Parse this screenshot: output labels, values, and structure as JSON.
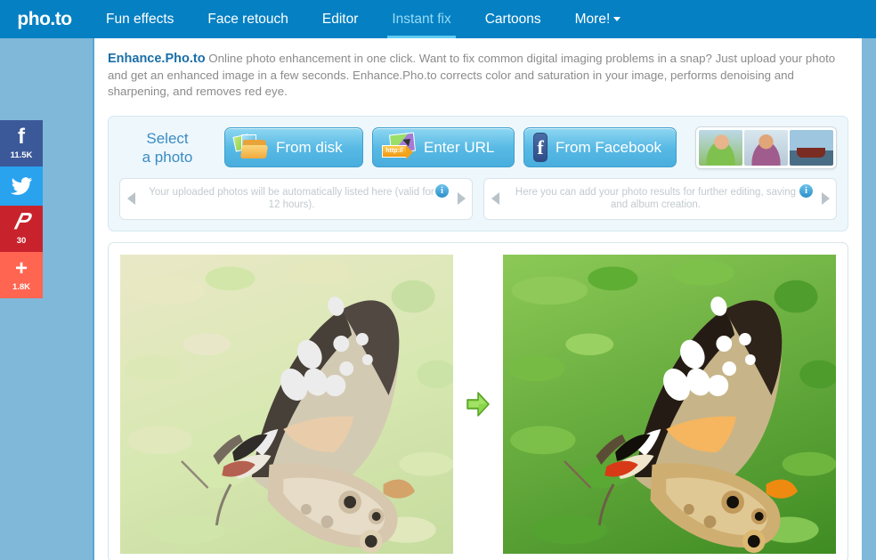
{
  "header": {
    "logo": "pho.to",
    "nav": [
      {
        "label": "Fun effects",
        "active": false
      },
      {
        "label": "Face retouch",
        "active": false
      },
      {
        "label": "Editor",
        "active": false
      },
      {
        "label": "Instant fix",
        "active": true
      },
      {
        "label": "Cartoons",
        "active": false
      },
      {
        "label": "More!",
        "active": false,
        "has_caret": true
      }
    ],
    "accent_color": "#0580c3",
    "active_color": "#96dcf5"
  },
  "social": [
    {
      "network": "facebook",
      "icon": "facebook-icon",
      "glyph": "f",
      "count": "11.5K",
      "color": "#3b5998"
    },
    {
      "network": "twitter",
      "icon": "twitter-icon",
      "glyph": "",
      "count": "",
      "color": "#2aa3ef"
    },
    {
      "network": "pinterest",
      "icon": "pinterest-icon",
      "glyph": "P",
      "count": "30",
      "color": "#c8232c"
    },
    {
      "network": "share",
      "icon": "plus-icon",
      "glyph": "+",
      "count": "1.8K",
      "color": "#ff6550"
    }
  ],
  "intro": {
    "title": "Enhance.Pho.to",
    "body": " Online photo enhancement in one click. Want to fix common digital imaging problems in a snap? Just upload your photo and get an enhanced image in a few seconds. Enhance.Pho.to corrects color and saturation in your image, performs denoising and sharpening, and removes red eye."
  },
  "select_panel": {
    "label_line1": "Select",
    "label_line2": "a photo",
    "buttons": [
      {
        "label": "From disk",
        "icon": "folder-photos-icon"
      },
      {
        "label": "Enter URL",
        "icon": "url-link-icon"
      },
      {
        "label": "From Facebook",
        "icon": "facebook-square-icon"
      }
    ],
    "samples": [
      {
        "name": "sample-woman",
        "alt": "woman portrait"
      },
      {
        "name": "sample-man",
        "alt": "man portrait"
      },
      {
        "name": "sample-ship",
        "alt": "ship photo"
      }
    ],
    "carousels": [
      {
        "text": "Your uploaded photos will be automatically listed here (valid for 12 hours).",
        "info": "i",
        "prev": "◀",
        "next": "▶"
      },
      {
        "text": "Here you can add your photo results for further editing, saving and album creation.",
        "info": "i",
        "prev": "◀",
        "next": "▶"
      }
    ]
  },
  "result": {
    "before_alt": "Painted Lady butterfly on green leaves, original washed-out photo",
    "after_alt": "Painted Lady butterfly on green leaves, color and contrast enhanced",
    "arrow_icon": "arrow-right-icon",
    "arrow_color": "#7ac943"
  }
}
